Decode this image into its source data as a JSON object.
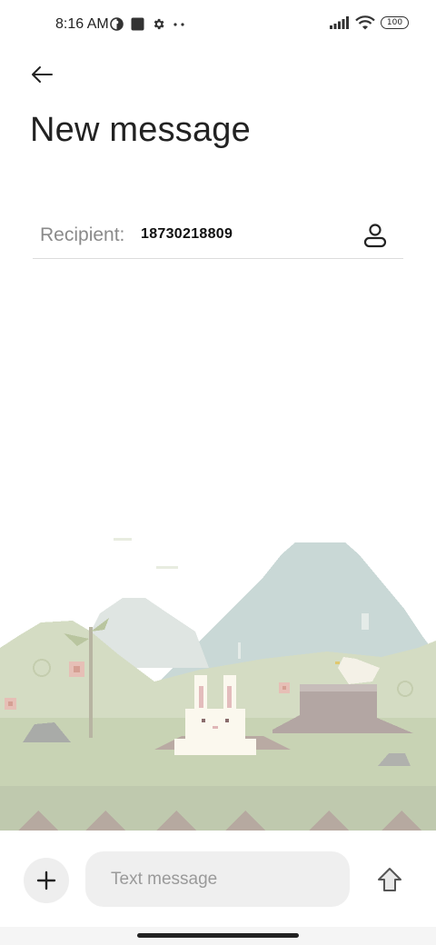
{
  "status_bar": {
    "time": "8:16 AM",
    "battery": "100",
    "icons": [
      "vpn-icon",
      "square-icon",
      "gear-icon",
      "more-dots-icon",
      "signal-icon",
      "wifi-icon",
      "battery-icon"
    ]
  },
  "header": {
    "back_icon": "arrow-left-icon",
    "title": "New message"
  },
  "recipient": {
    "label": "Recipient:",
    "value": "18730218809",
    "contact_icon": "person-icon"
  },
  "composer": {
    "add_icon": "plus-icon",
    "placeholder": "Text message",
    "value": "",
    "send_icon": "send-arrow-icon"
  },
  "colors": {
    "background": "#ffffff",
    "input_bg": "#efefef",
    "label_gray": "#8a8a8a",
    "scene_grass": "#c8d3b4",
    "scene_mountain": "#c9d8d6"
  }
}
